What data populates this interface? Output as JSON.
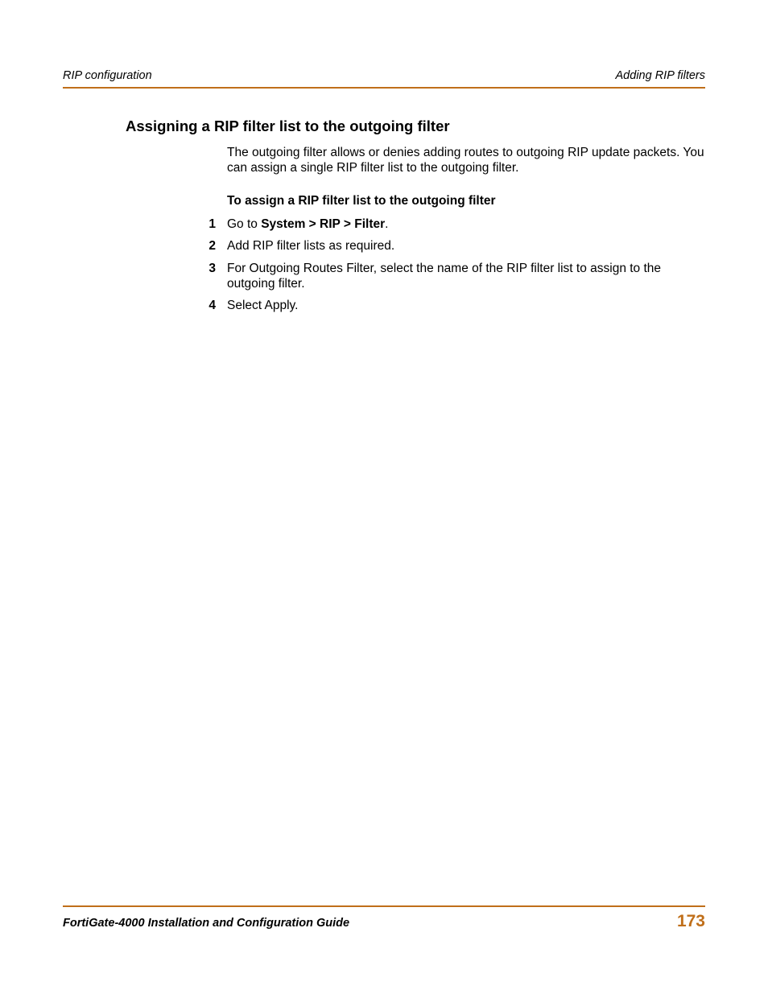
{
  "header": {
    "left": "RIP configuration",
    "right": "Adding RIP filters"
  },
  "section": {
    "heading": "Assigning a RIP filter list to the outgoing filter",
    "intro": "The outgoing filter allows or denies adding routes to outgoing RIP update packets. You can assign a single RIP filter list to the outgoing filter.",
    "procedure_title": "To assign a RIP filter list to the outgoing filter",
    "steps": [
      {
        "num": "1",
        "prefix": "Go to ",
        "bold": "System > RIP > Filter",
        "suffix": "."
      },
      {
        "num": "2",
        "prefix": "Add RIP filter lists as required.",
        "bold": "",
        "suffix": ""
      },
      {
        "num": "3",
        "prefix": "For Outgoing Routes Filter, select the name of the RIP filter list to assign to the outgoing filter.",
        "bold": "",
        "suffix": ""
      },
      {
        "num": "4",
        "prefix": "Select Apply.",
        "bold": "",
        "suffix": ""
      }
    ]
  },
  "footer": {
    "title": "FortiGate-4000 Installation and Configuration Guide",
    "page": "173"
  },
  "colors": {
    "accent": "#c06f1a"
  }
}
